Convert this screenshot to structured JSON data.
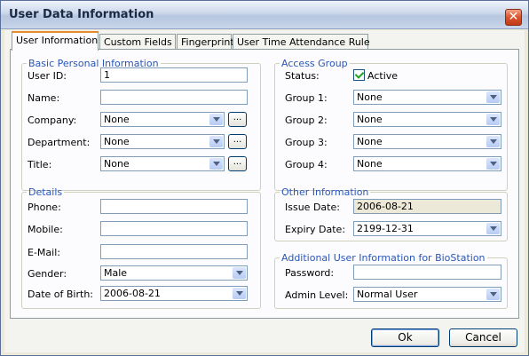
{
  "window": {
    "title": "User Data Information",
    "close_glyph": "✕"
  },
  "tabs": [
    {
      "label": "User Information",
      "active": true
    },
    {
      "label": "Custom Fields"
    },
    {
      "label": "Fingerprint"
    },
    {
      "label": "User Time Attendance Rule"
    }
  ],
  "basic": {
    "legend": "Basic Personal Information",
    "user_id_label": "User ID:",
    "user_id": "1",
    "name_label": "Name:",
    "name": "",
    "company_label": "Company:",
    "company": "None",
    "department_label": "Department:",
    "department": "None",
    "title_label": "Title:",
    "title": "None",
    "ellipsis": "..."
  },
  "access": {
    "legend": "Access Group",
    "status_label": "Status:",
    "status_checked": true,
    "status_text": "Active",
    "group1_label": "Group 1:",
    "group1": "None",
    "group2_label": "Group 2:",
    "group2": "None",
    "group3_label": "Group 3:",
    "group3": "None",
    "group4_label": "Group 4:",
    "group4": "None"
  },
  "details": {
    "legend": "Details",
    "phone_label": "Phone:",
    "phone": "",
    "mobile_label": "Mobile:",
    "mobile": "",
    "email_label": "E-Mail:",
    "email": "",
    "gender_label": "Gender:",
    "gender": "Male",
    "dob_label": "Date of Birth:",
    "dob": "2006-08-21"
  },
  "other": {
    "legend": "Other Information",
    "issue_label": "Issue Date:",
    "issue": "2006-08-21",
    "expiry_label": "Expiry Date:",
    "expiry": "2199-12-31"
  },
  "bio": {
    "legend": "Additional User Information for BioStation",
    "password_label": "Password:",
    "password": "",
    "admin_label": "Admin Level:",
    "admin": "Normal User"
  },
  "buttons": {
    "ok": "Ok",
    "cancel": "Cancel"
  },
  "colors": {
    "accent_tab": "#e68b2c",
    "legend_text": "#2a56b8",
    "close_button": "#d8532c"
  }
}
